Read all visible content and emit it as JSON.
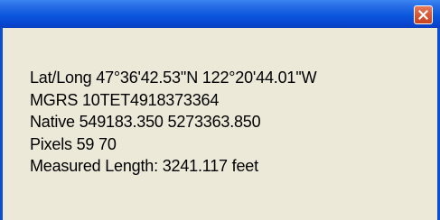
{
  "window": {
    "close_icon": "close-x-icon"
  },
  "info": {
    "lat_long": "Lat/Long 47°36'42.53''N 122°20'44.01''W",
    "mgrs": "MGRS 10TET4918373364",
    "native": "Native 549183.350 5273363.850",
    "pixels": "Pixels 59 70",
    "measured_length": "Measured Length: 3241.117 feet"
  },
  "colors": {
    "titlebar": "#0a4ed2",
    "client_background": "#ece9d8",
    "close_button": "#d95b38"
  }
}
